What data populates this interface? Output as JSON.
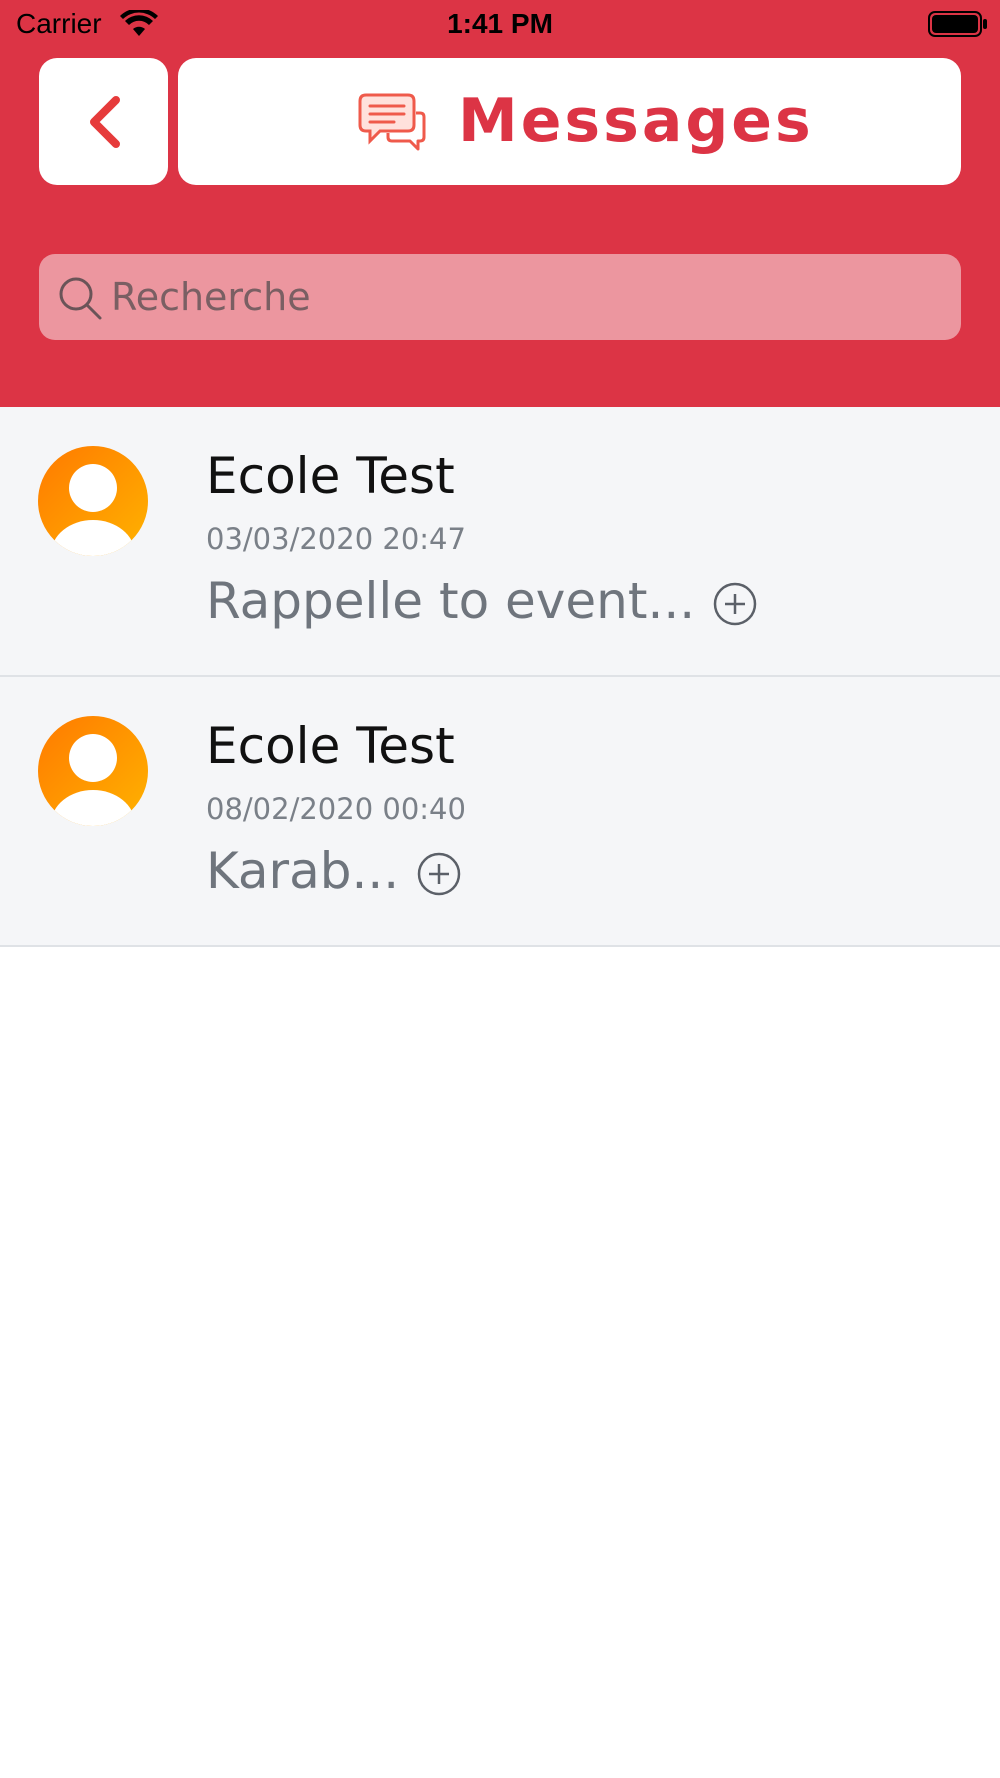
{
  "status_bar": {
    "carrier": "Carrier",
    "time": "1:41 PM"
  },
  "header": {
    "title": "Messages"
  },
  "search": {
    "placeholder": "Recherche"
  },
  "messages": [
    {
      "sender": "Ecole Test",
      "date": "03/03/2020 20:47",
      "preview": "Rappelle to event..."
    },
    {
      "sender": "Ecole Test",
      "date": "08/02/2020 00:40",
      "preview": "Karab..."
    }
  ],
  "colors": {
    "brand": "#dc3445",
    "row_background": "#f5f6f8",
    "avatar_gradient": [
      "#ff7a00",
      "#ffb300"
    ]
  }
}
